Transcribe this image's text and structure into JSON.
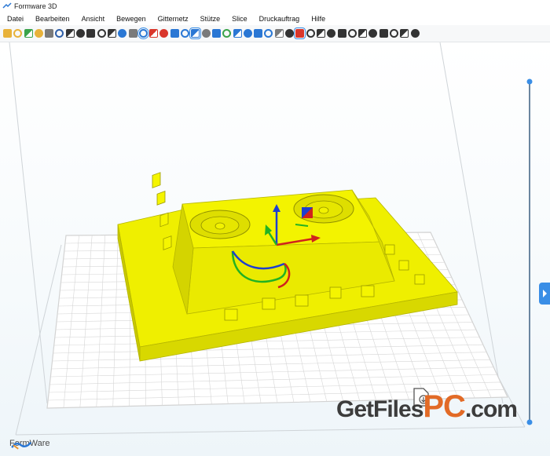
{
  "window": {
    "title": "Formware 3D"
  },
  "menu": [
    "Datei",
    "Bearbeiten",
    "Ansicht",
    "Bewegen",
    "Gitternetz",
    "Stütze",
    "Slice",
    "Druckauftrag",
    "Hilfe"
  ],
  "toolbar": {
    "icons": [
      "new-file-icon",
      "open-folder-icon",
      "open-recent-icon",
      "import-icon",
      "export-icon",
      "save-icon",
      "screenshot-icon",
      "print-icon",
      "settings-icon",
      "move-icon",
      "pen-icon",
      "undo-icon",
      "redo-icon",
      "view-perspective-icon",
      "view-front-icon",
      "view-side-icon",
      "view-top-icon",
      "view-iso-icon",
      "view-sphere-icon",
      "view-wire-icon",
      "view-dots-icon",
      "view-globe-icon",
      "support-tree-icon",
      "support-points-icon",
      "support-auto-icon",
      "support-branch-icon",
      "grid-icon",
      "cylinder-icon",
      "record-icon",
      "raft-icon",
      "fixture-icon",
      "slice-a-icon",
      "slice-b-icon",
      "slice-c-icon",
      "slice-d-icon",
      "slice-e-icon",
      "tool-cross-icon",
      "tool-move-icon",
      "tool-plus-icon",
      "tool-gallery-icon"
    ],
    "selected_index": [
      13,
      18,
      28
    ],
    "colors": {
      "file": "#e8b23a",
      "save": "#2f5fa8",
      "dark": "#333333",
      "blue": "#2a77d4",
      "red": "#d9362b",
      "green": "#3aa34a",
      "gray": "#7a7a7a"
    }
  },
  "viewport": {
    "model_color": "#ecec00",
    "model_shadow": "#c9c900",
    "bed_grid_color": "#d6d6d6",
    "frame_color": "#cfd4d8",
    "slider_color": "#6b86a0"
  },
  "brand": {
    "name": "FormWare"
  },
  "watermark": {
    "part1": "GetFiles",
    "part2": "PC",
    "part3": ".com"
  }
}
